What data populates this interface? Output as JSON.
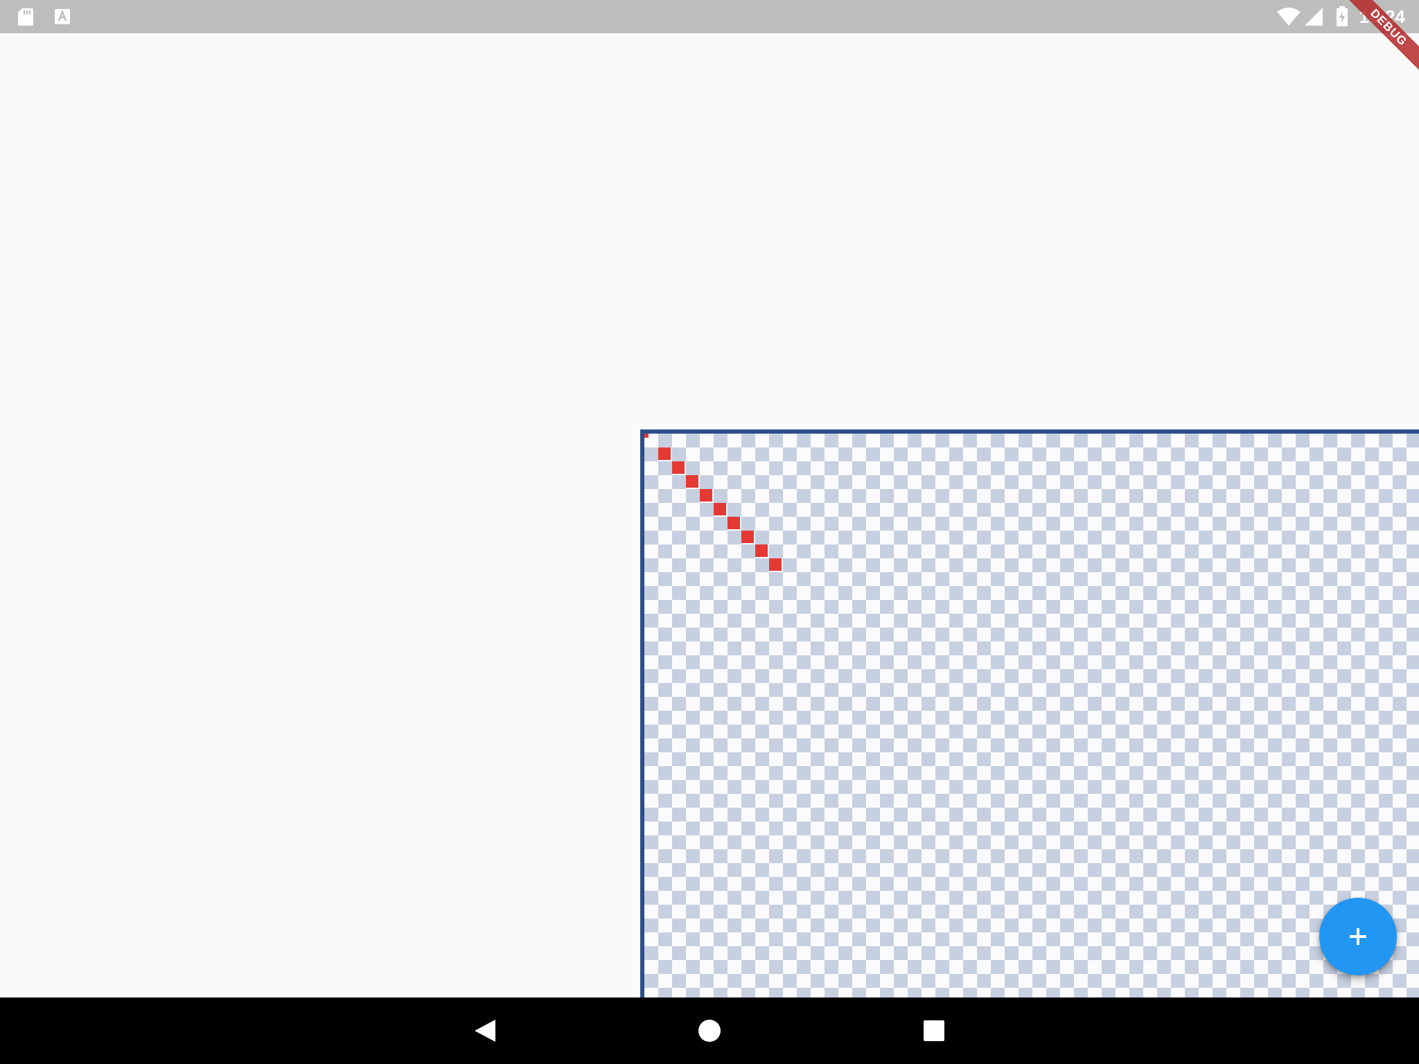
{
  "status_bar": {
    "time": "10:24",
    "icons": [
      "sd-card-icon",
      "text-a-icon",
      "wifi-icon",
      "cell-signal-icon",
      "battery-charging-icon"
    ],
    "background": "#bdbdbd"
  },
  "debug_banner": {
    "label": "DEBUG",
    "color": "#b42828"
  },
  "canvas": {
    "border_color": "#2c4f8c",
    "checker_color": "#c7d0e0",
    "stroke_color": "#e53935",
    "stroke_segment_count": 10
  },
  "fab": {
    "icon": "plus-icon",
    "color": "#2196f3"
  },
  "nav_bar": {
    "buttons": [
      "back-icon",
      "home-icon",
      "recents-icon"
    ],
    "background": "#000000"
  }
}
